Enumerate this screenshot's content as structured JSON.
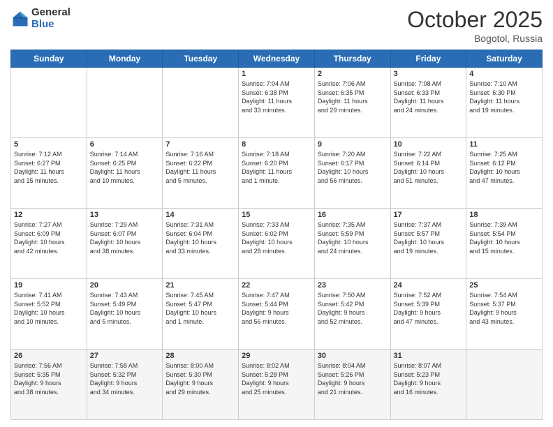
{
  "header": {
    "logo_general": "General",
    "logo_blue": "Blue",
    "title": "October 2025",
    "location": "Bogotol, Russia"
  },
  "days_of_week": [
    "Sunday",
    "Monday",
    "Tuesday",
    "Wednesday",
    "Thursday",
    "Friday",
    "Saturday"
  ],
  "weeks": [
    [
      {
        "day": "",
        "text": ""
      },
      {
        "day": "",
        "text": ""
      },
      {
        "day": "",
        "text": ""
      },
      {
        "day": "1",
        "text": "Sunrise: 7:04 AM\nSunset: 6:38 PM\nDaylight: 11 hours\nand 33 minutes."
      },
      {
        "day": "2",
        "text": "Sunrise: 7:06 AM\nSunset: 6:35 PM\nDaylight: 11 hours\nand 29 minutes."
      },
      {
        "day": "3",
        "text": "Sunrise: 7:08 AM\nSunset: 6:33 PM\nDaylight: 11 hours\nand 24 minutes."
      },
      {
        "day": "4",
        "text": "Sunrise: 7:10 AM\nSunset: 6:30 PM\nDaylight: 11 hours\nand 19 minutes."
      }
    ],
    [
      {
        "day": "5",
        "text": "Sunrise: 7:12 AM\nSunset: 6:27 PM\nDaylight: 11 hours\nand 15 minutes."
      },
      {
        "day": "6",
        "text": "Sunrise: 7:14 AM\nSunset: 6:25 PM\nDaylight: 11 hours\nand 10 minutes."
      },
      {
        "day": "7",
        "text": "Sunrise: 7:16 AM\nSunset: 6:22 PM\nDaylight: 11 hours\nand 5 minutes."
      },
      {
        "day": "8",
        "text": "Sunrise: 7:18 AM\nSunset: 6:20 PM\nDaylight: 11 hours\nand 1 minute."
      },
      {
        "day": "9",
        "text": "Sunrise: 7:20 AM\nSunset: 6:17 PM\nDaylight: 10 hours\nand 56 minutes."
      },
      {
        "day": "10",
        "text": "Sunrise: 7:22 AM\nSunset: 6:14 PM\nDaylight: 10 hours\nand 51 minutes."
      },
      {
        "day": "11",
        "text": "Sunrise: 7:25 AM\nSunset: 6:12 PM\nDaylight: 10 hours\nand 47 minutes."
      }
    ],
    [
      {
        "day": "12",
        "text": "Sunrise: 7:27 AM\nSunset: 6:09 PM\nDaylight: 10 hours\nand 42 minutes."
      },
      {
        "day": "13",
        "text": "Sunrise: 7:29 AM\nSunset: 6:07 PM\nDaylight: 10 hours\nand 38 minutes."
      },
      {
        "day": "14",
        "text": "Sunrise: 7:31 AM\nSunset: 6:04 PM\nDaylight: 10 hours\nand 33 minutes."
      },
      {
        "day": "15",
        "text": "Sunrise: 7:33 AM\nSunset: 6:02 PM\nDaylight: 10 hours\nand 28 minutes."
      },
      {
        "day": "16",
        "text": "Sunrise: 7:35 AM\nSunset: 5:59 PM\nDaylight: 10 hours\nand 24 minutes."
      },
      {
        "day": "17",
        "text": "Sunrise: 7:37 AM\nSunset: 5:57 PM\nDaylight: 10 hours\nand 19 minutes."
      },
      {
        "day": "18",
        "text": "Sunrise: 7:39 AM\nSunset: 5:54 PM\nDaylight: 10 hours\nand 15 minutes."
      }
    ],
    [
      {
        "day": "19",
        "text": "Sunrise: 7:41 AM\nSunset: 5:52 PM\nDaylight: 10 hours\nand 10 minutes."
      },
      {
        "day": "20",
        "text": "Sunrise: 7:43 AM\nSunset: 5:49 PM\nDaylight: 10 hours\nand 5 minutes."
      },
      {
        "day": "21",
        "text": "Sunrise: 7:45 AM\nSunset: 5:47 PM\nDaylight: 10 hours\nand 1 minute."
      },
      {
        "day": "22",
        "text": "Sunrise: 7:47 AM\nSunset: 5:44 PM\nDaylight: 9 hours\nand 56 minutes."
      },
      {
        "day": "23",
        "text": "Sunrise: 7:50 AM\nSunset: 5:42 PM\nDaylight: 9 hours\nand 52 minutes."
      },
      {
        "day": "24",
        "text": "Sunrise: 7:52 AM\nSunset: 5:39 PM\nDaylight: 9 hours\nand 47 minutes."
      },
      {
        "day": "25",
        "text": "Sunrise: 7:54 AM\nSunset: 5:37 PM\nDaylight: 9 hours\nand 43 minutes."
      }
    ],
    [
      {
        "day": "26",
        "text": "Sunrise: 7:56 AM\nSunset: 5:35 PM\nDaylight: 9 hours\nand 38 minutes."
      },
      {
        "day": "27",
        "text": "Sunrise: 7:58 AM\nSunset: 5:32 PM\nDaylight: 9 hours\nand 34 minutes."
      },
      {
        "day": "28",
        "text": "Sunrise: 8:00 AM\nSunset: 5:30 PM\nDaylight: 9 hours\nand 29 minutes."
      },
      {
        "day": "29",
        "text": "Sunrise: 8:02 AM\nSunset: 5:28 PM\nDaylight: 9 hours\nand 25 minutes."
      },
      {
        "day": "30",
        "text": "Sunrise: 8:04 AM\nSunset: 5:26 PM\nDaylight: 9 hours\nand 21 minutes."
      },
      {
        "day": "31",
        "text": "Sunrise: 8:07 AM\nSunset: 5:23 PM\nDaylight: 9 hours\nand 16 minutes."
      },
      {
        "day": "",
        "text": ""
      }
    ]
  ]
}
